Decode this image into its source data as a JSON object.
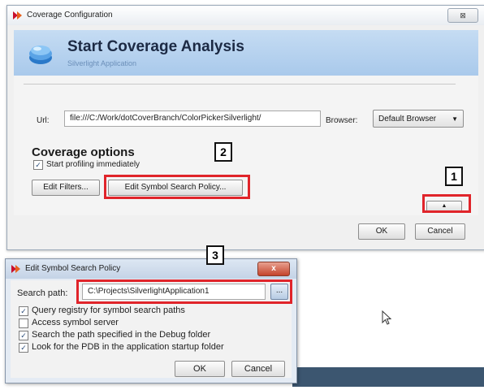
{
  "main_window": {
    "title": "Coverage Configuration",
    "close_label": "⊠",
    "banner_title": "Start Coverage Analysis",
    "banner_subtitle": "Silverlight Application",
    "url_label": "Url:",
    "url_value": "file:///C:/Work/dotCoverBranch/ColorPickerSilverlight/",
    "browser_label": "Browser:",
    "browser_value": "Default Browser",
    "coverage_options_title": "Coverage options",
    "start_profiling_label": "Start profiling immediately",
    "start_profiling_checked": true,
    "edit_filters_label": "Edit Filters...",
    "edit_symbol_policy_label": "Edit Symbol Search Policy...",
    "expand_label": "▲",
    "ok_label": "OK",
    "cancel_label": "Cancel"
  },
  "callouts": [
    "1",
    "2",
    "3"
  ],
  "dialog": {
    "title": "Edit Symbol Search Policy",
    "close_label": "x",
    "search_path_label": "Search path:",
    "search_path_value": "C:\\Projects\\SilverlightApplication1",
    "browse_label": "...",
    "options": [
      {
        "label": "Query registry for symbol search paths",
        "checked": true
      },
      {
        "label": "Access symbol server",
        "checked": false
      },
      {
        "label": "Search the path specified in the Debug folder",
        "checked": true
      },
      {
        "label": "Look for the PDB in the application startup folder",
        "checked": true
      }
    ],
    "ok_label": "OK",
    "cancel_label": "Cancel"
  },
  "colors": {
    "highlight_red": "#e0242a",
    "banner_blue": "#b6d1ee",
    "logo_red": "#c8102e"
  },
  "icons": [
    "dotcover-logo-icon",
    "analysis-icon",
    "mouse-cursor-icon",
    "chevron-down-icon",
    "check-icon"
  ]
}
